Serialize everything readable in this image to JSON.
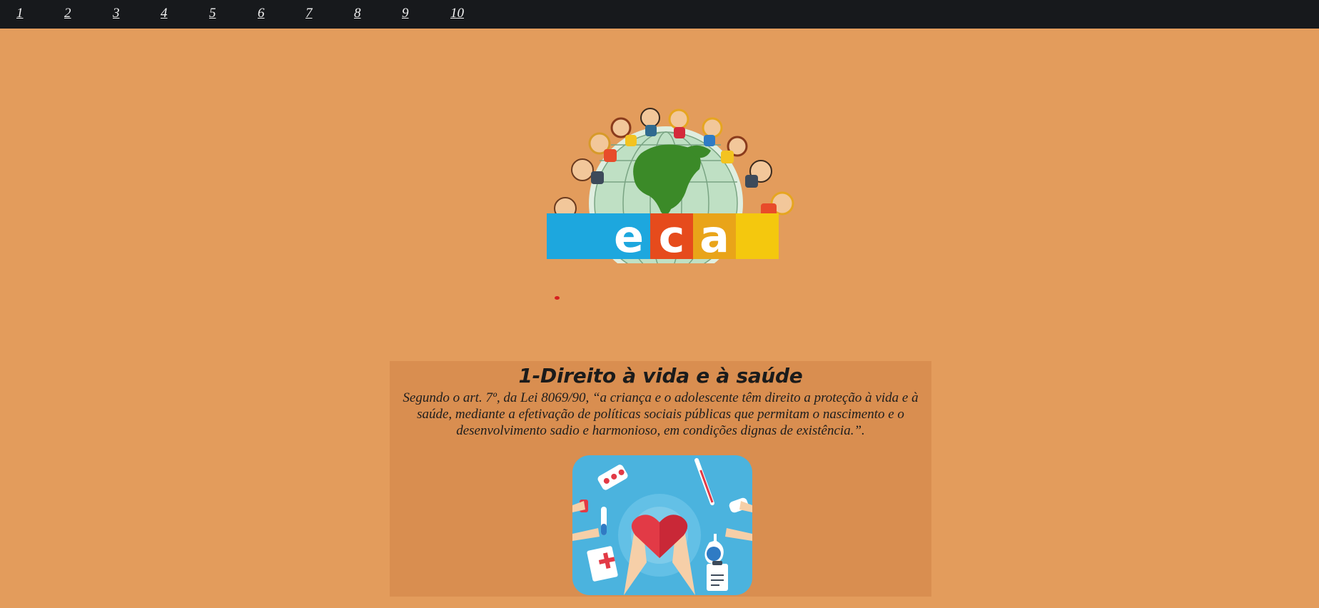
{
  "nav": {
    "links": [
      "1",
      "2",
      "3",
      "4",
      "5",
      "6",
      "7",
      "8",
      "9",
      "10"
    ]
  },
  "logo": {
    "text_e": "e",
    "text_c": "c",
    "text_a": "a"
  },
  "section": {
    "title": "1-Direito à vida e à saúde",
    "body": "Segundo o art. 7º, da Lei 8069/90, “a criança e o adolescente têm direito a proteção à vida e à saúde, mediante a efetivação de políticas sociais públicas que permitam o nascimento e o desenvolvimento sadio e harmonioso, em condições dignas de existência.”."
  },
  "colors": {
    "background": "#e39c5c",
    "nav": "#17191c",
    "card": "#d98e50"
  }
}
